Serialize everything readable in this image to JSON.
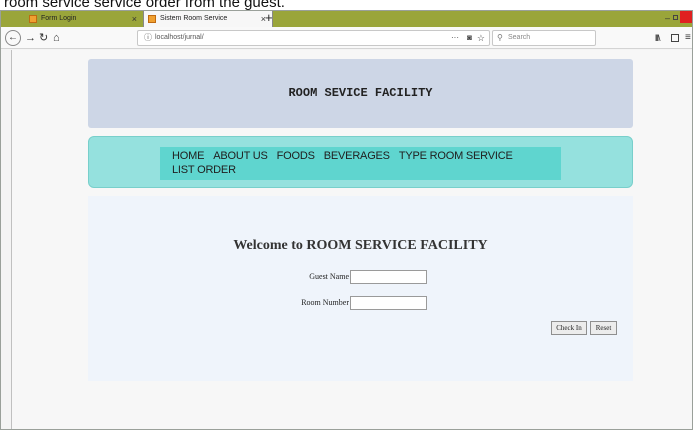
{
  "caption": "room service service order from the guest.",
  "browser": {
    "tabs": [
      {
        "label": "Form Login",
        "active": false
      },
      {
        "label": "Sistem Room Service",
        "active": true
      }
    ],
    "new_tab": "+",
    "tab_close": "×",
    "url": "localhost/jurnal/",
    "search_placeholder": "Search",
    "icons": [
      "back-icon",
      "forward-icon",
      "reload-icon",
      "home-icon",
      "info-icon",
      "page-actions-icon",
      "pocket-icon",
      "bookmark-star-icon",
      "search-icon",
      "library-icon",
      "sidebar-icon",
      "menu-icon"
    ]
  },
  "page": {
    "header_title": "ROOM SEVICE FACILITY",
    "menu": [
      "HOME",
      "ABOUT US",
      "FOODS",
      "BEVERAGES",
      "TYPE ROOM SERVICE",
      "LIST ORDER"
    ],
    "welcome": "Welcome to ROOM SERVICE FACILITY",
    "form": {
      "guest_name_label": "Guest Name",
      "guest_name_value": "",
      "room_number_label": "Room Number",
      "room_number_value": "",
      "check_in_label": "Check In",
      "reset_label": "Reset"
    }
  },
  "colors": {
    "header_bg": "#cdd6e6",
    "menu_bg": "#95e1de",
    "menu_inner_bg": "#5fd5cf",
    "content_bg": "#eff4fb",
    "tabbar_bg": "#9aa53a"
  }
}
